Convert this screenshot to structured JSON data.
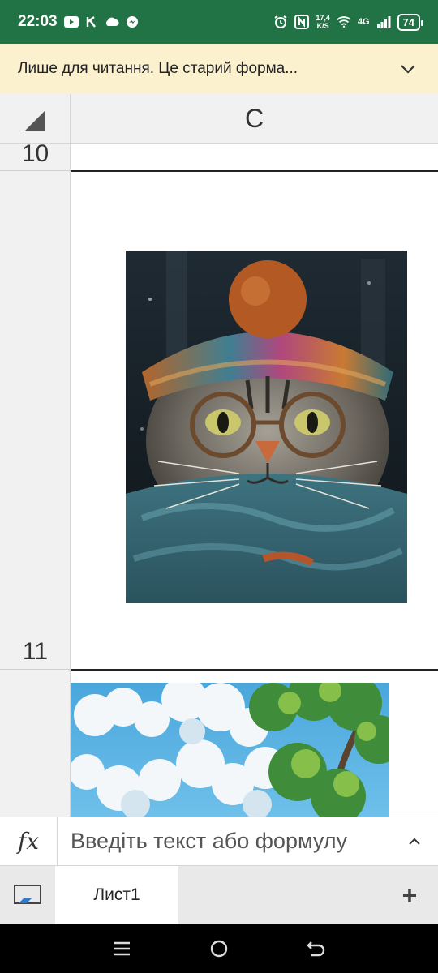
{
  "status_bar": {
    "time": "22:03",
    "speed_value": "17,4",
    "speed_unit": "K/S",
    "network": "4G",
    "battery": "74",
    "left_icons": [
      "youtube-icon",
      "k-app-icon",
      "cloud-icon",
      "messenger-icon"
    ],
    "right_icons": [
      "alarm-icon",
      "nfc-icon",
      "wifi-icon",
      "signal-icon"
    ]
  },
  "banner": {
    "text": "Лише для читання. Це старий форма..."
  },
  "sheet": {
    "column_header": "C",
    "rows": [
      "10",
      "11"
    ]
  },
  "images": {
    "first": "cat-in-knit-hat-picture",
    "second": "sky-and-tree-picture"
  },
  "formula_bar": {
    "fx_label": "fx",
    "placeholder": "Введіть текст або формулу"
  },
  "tabs": {
    "sheets": [
      "Лист1"
    ],
    "add_label": "+"
  },
  "colors": {
    "accent": "#217346",
    "banner_bg": "#fbf1cf"
  }
}
